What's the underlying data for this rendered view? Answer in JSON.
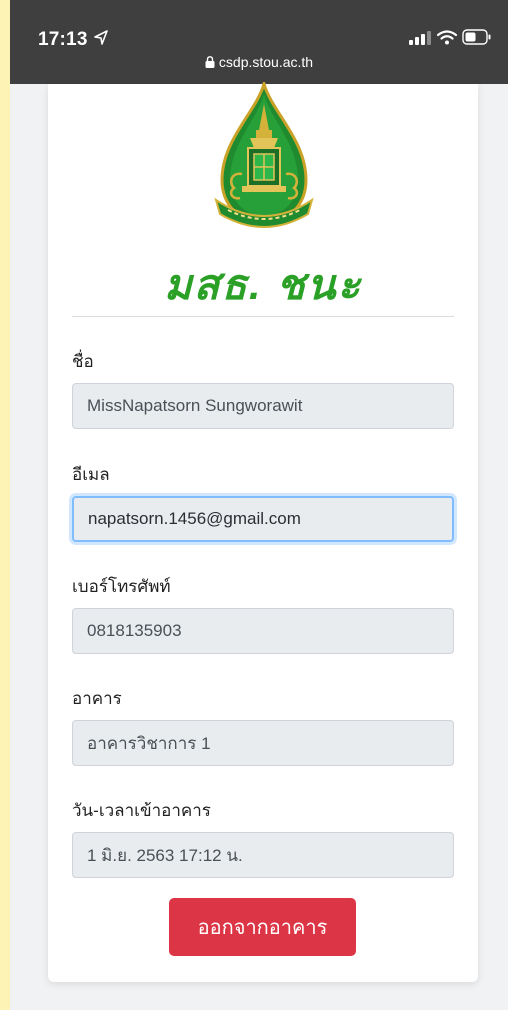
{
  "status_bar": {
    "time": "17:13",
    "url": "csdp.stou.ac.th"
  },
  "brand": {
    "title": "มสธ. ชนะ",
    "color": "#2aa126"
  },
  "form": {
    "name": {
      "label": "ชื่อ",
      "value": "MissNapatsorn Sungworawit"
    },
    "email": {
      "label": "อีเมล",
      "value": "napatsorn.1456@gmail.com"
    },
    "phone": {
      "label": "เบอร์โทรศัพท์",
      "value": "0818135903"
    },
    "building": {
      "label": "อาคาร",
      "value": "อาคารวิชาการ 1"
    },
    "checkin": {
      "label": "วัน-เวลาเข้าอาคาร",
      "value": "1 มิ.ย. 2563 17:12 น."
    }
  },
  "actions": {
    "exit_label": "ออกจากอาคาร",
    "exit_color": "#dc3545"
  },
  "icons": {
    "location": "location-arrow-icon",
    "signal": "cellular-signal-icon",
    "wifi": "wifi-icon",
    "battery": "battery-icon",
    "lock": "lock-icon",
    "logo": "university-seal-logo"
  }
}
